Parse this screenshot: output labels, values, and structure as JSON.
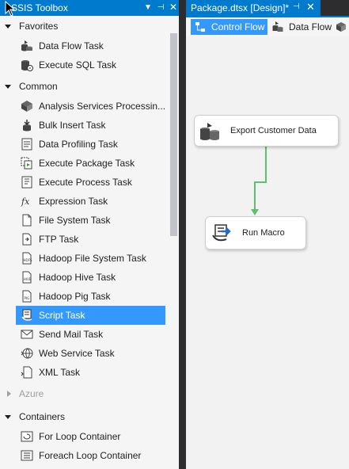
{
  "toolbox": {
    "title": "SSIS Toolbox",
    "groups": [
      {
        "label": "Favorites",
        "items": [
          {
            "label": "Data Flow Task",
            "icon": "data-flow-task-icon"
          },
          {
            "label": "Execute SQL Task",
            "icon": "execute-sql-task-icon"
          }
        ]
      },
      {
        "label": "Common",
        "items": [
          {
            "label": "Analysis Services Processin...",
            "icon": "analysis-services-icon"
          },
          {
            "label": "Bulk Insert Task",
            "icon": "bulk-insert-icon"
          },
          {
            "label": "Data Profiling Task",
            "icon": "data-profiling-icon"
          },
          {
            "label": "Execute Package Task",
            "icon": "execute-package-icon"
          },
          {
            "label": "Execute Process Task",
            "icon": "execute-process-icon"
          },
          {
            "label": "Expression Task",
            "icon": "expression-fx-icon"
          },
          {
            "label": "File System Task",
            "icon": "file-system-icon"
          },
          {
            "label": "FTP Task",
            "icon": "ftp-icon"
          },
          {
            "label": "Hadoop File System Task",
            "icon": "hdfs-icon"
          },
          {
            "label": "Hadoop Hive Task",
            "icon": "hive-icon"
          },
          {
            "label": "Hadoop Pig Task",
            "icon": "pig-icon"
          },
          {
            "label": "Script Task",
            "icon": "script-task-icon"
          },
          {
            "label": "Send Mail Task",
            "icon": "mail-icon"
          },
          {
            "label": "Web Service Task",
            "icon": "web-service-icon"
          },
          {
            "label": "XML Task",
            "icon": "xml-icon"
          }
        ]
      },
      {
        "label": "Azure",
        "items": []
      },
      {
        "label": "Containers",
        "items": [
          {
            "label": "For Loop Container",
            "icon": "for-loop-icon"
          },
          {
            "label": "Foreach Loop Container",
            "icon": "foreach-loop-icon"
          }
        ]
      }
    ],
    "selected_item": "Script Task"
  },
  "document_tab": {
    "title": "Package.dtsx [Design]*",
    "pin_icon": "pin-icon",
    "close_icon": "close-icon"
  },
  "designer_tabs": {
    "control_flow": "Control Flow",
    "data_flow": "Data Flow"
  },
  "canvas": {
    "tasks": [
      {
        "label": "Export Customer Data",
        "icon": "data-flow-task-icon"
      },
      {
        "label": "Run Macro",
        "icon": "script-task-icon"
      }
    ],
    "connector_color": "#5fbf6f"
  },
  "colors": {
    "accent": "#007acc",
    "selection": "#3399ff",
    "chrome": "#2d2d30",
    "panel": "#f5f5f5"
  }
}
